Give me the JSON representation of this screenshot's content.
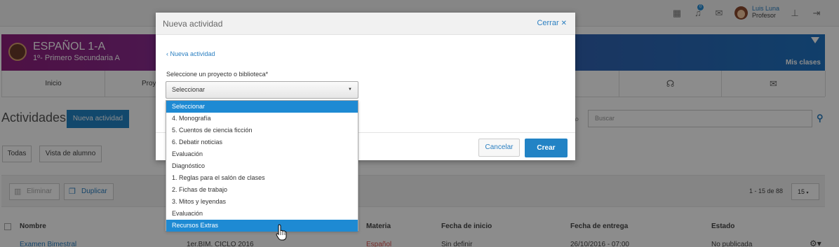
{
  "topbar": {
    "notification_count": "0",
    "user_name": "Luis Luna",
    "user_role": "Profesor",
    "icons": [
      "calendar-icon",
      "bell-icon",
      "mail-icon",
      "sitemap-icon",
      "logout-icon"
    ]
  },
  "banner": {
    "title": "ESPAÑOL 1-A",
    "subtitle": "1º- Primero Secundaria A",
    "mis_clases": "Mis clases",
    "gradient": [
      "#8e1f7d",
      "#1f73c2"
    ]
  },
  "tabs": [
    {
      "label": "Inicio"
    },
    {
      "label": "Proyectos"
    }
  ],
  "activities": {
    "title": "Actividades",
    "new_button": "Nueva actividad",
    "search_placeholder": "Buscar",
    "filters": [
      "Todas",
      "Vista de alumno"
    ],
    "delete_label": "Eliminar",
    "duplicate_label": "Duplicar",
    "pager_text": "1 - 15 de 88",
    "page_size": "15",
    "columns": [
      "Nombre",
      "Materia",
      "Fecha de inicio",
      "Fecha de entrega",
      "Estado"
    ],
    "first_row": {
      "name": "Examen Bimestral",
      "project": "1er.BIM. CICLO 2016",
      "subject": "Español",
      "start": "Sin definir",
      "due": "26/10/2016 - 07:00",
      "status": "No publicada"
    }
  },
  "modal": {
    "title": "Nueva actividad",
    "close_label": "Cerrar",
    "back_link": "Nueva actividad",
    "select_label": "Seleccione un proyecto o biblioteca*",
    "select_value": "Seleccionar",
    "cancel_label": "Cancelar",
    "create_label": "Crear"
  },
  "dropdown": {
    "options": [
      "Seleccionar",
      "4. Monografía",
      "5. Cuentos de ciencia ficción",
      "6. Debatir noticias",
      "Evaluación",
      "Diagnóstico",
      "1. Reglas para el salón de clases",
      "2. Fichas de trabajo",
      "3. Mitos y leyendas",
      "Evaluación",
      "Recursos Extras"
    ],
    "selected_index": 0,
    "hovered_index": 10,
    "highlight_color": "#1e8ad3"
  },
  "colors": {
    "accent": "#2283c5",
    "link": "#2a7fc1",
    "subject_red": "#d9534f"
  }
}
